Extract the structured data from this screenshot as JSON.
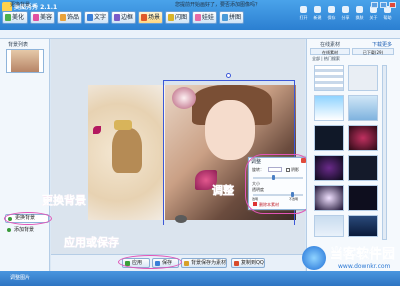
{
  "app": {
    "title": "美图秀秀 2.1.1"
  },
  "tabs": [
    "美化",
    "美容",
    "饰品",
    "文字",
    "边框",
    "场景",
    "闪图",
    "娃娃",
    "拼图"
  ],
  "toolbar_buttons": [
    "打开",
    "新建",
    "保存",
    "分享",
    "换肤",
    "关于",
    "帮助"
  ],
  "toolbar": {
    "left": "更换背景，",
    "center": "您提前开始画好了，要否添加图像吗？"
  },
  "left_panel": {
    "title": "背景列表",
    "change_bg": "更换背景",
    "add_bg": "添加背景"
  },
  "annotations": {
    "change": "更换背景",
    "adjust": "调整",
    "apply": "应用或保存"
  },
  "adjust_panel": {
    "title": "调整",
    "rotate_label": "旋转：",
    "shadow_label": "阴影",
    "size_label": "大小",
    "opacity_label": "透明度",
    "opacity_min": "透明",
    "opacity_max": "不透明",
    "delete": "删除本素材"
  },
  "bottom_buttons": [
    "应用",
    "保存",
    "背景保存为素材",
    "复制到QQ"
  ],
  "right_panel": {
    "title": "在线素材",
    "more": "下载更多",
    "tabs": [
      "在线素材",
      "已下载(29)"
    ],
    "sub": "全部 | 热门搜索"
  },
  "status": {
    "text": "调整图片"
  },
  "watermark": {
    "text": "当客软件园",
    "url": "www.downkr.com"
  }
}
